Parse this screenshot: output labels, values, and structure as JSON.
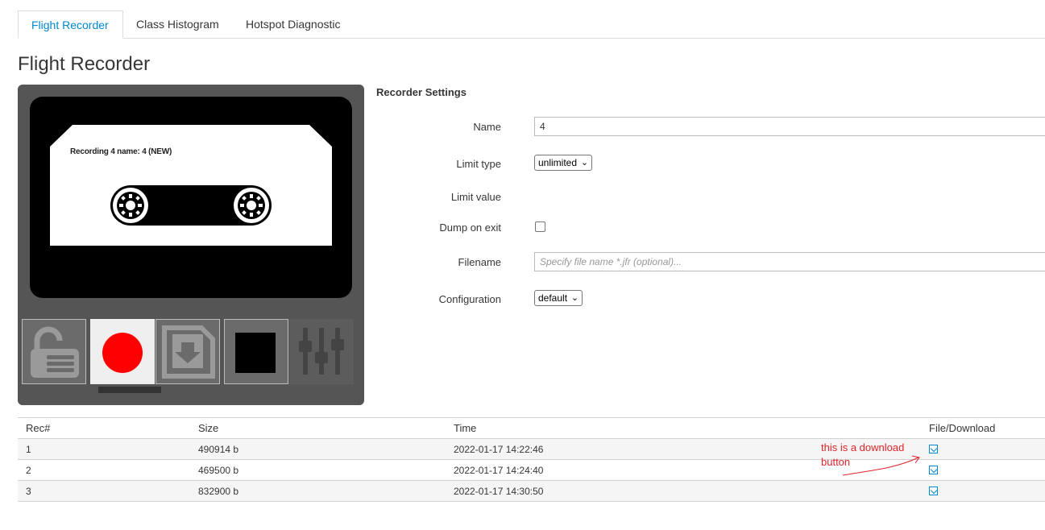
{
  "tabs": [
    {
      "label": "Flight Recorder",
      "active": true
    },
    {
      "label": "Class Histogram",
      "active": false
    },
    {
      "label": "Hotspot Diagnostic",
      "active": false
    }
  ],
  "page_title": "Flight Recorder",
  "cassette": {
    "label": "Recording 4 name: 4 (NEW)"
  },
  "controls": [
    "unlock-icon",
    "record-icon",
    "save-icon",
    "stop-icon",
    "settings-sliders-icon"
  ],
  "settings": {
    "title": "Recorder Settings",
    "name_label": "Name",
    "name_value": "4",
    "limit_type_label": "Limit type",
    "limit_type_value": "unlimited",
    "limit_value_label": "Limit value",
    "dump_on_exit_label": "Dump on exit",
    "dump_on_exit_checked": false,
    "filename_label": "Filename",
    "filename_placeholder": "Specify file name *.jfr (optional)...",
    "configuration_label": "Configuration",
    "configuration_value": "default"
  },
  "table": {
    "headers": [
      "Rec#",
      "Size",
      "Time",
      "File/Download"
    ],
    "rows": [
      {
        "rec": "1",
        "size": "490914 b",
        "time": "2022-01-17 14:22:46"
      },
      {
        "rec": "2",
        "size": "469500 b",
        "time": "2022-01-17 14:24:40"
      },
      {
        "rec": "3",
        "size": "832900 b",
        "time": "2022-01-17 14:30:50"
      }
    ]
  },
  "annotation": {
    "text": "this is a download button",
    "color": "#e0242a"
  },
  "colors": {
    "accent": "#0088ce",
    "record": "#ff0000",
    "panel": "#555555"
  }
}
